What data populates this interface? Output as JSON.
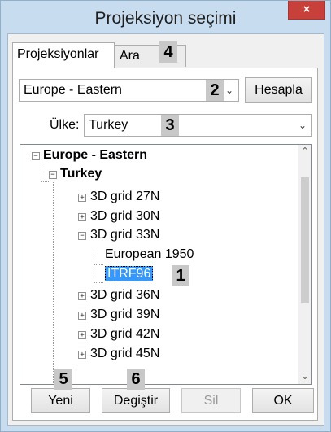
{
  "window": {
    "title": "Projeksiyon seçimi",
    "close_label": "×"
  },
  "tabs": [
    {
      "label": "Projeksiyonlar",
      "active": true
    },
    {
      "label": "Ara",
      "active": false
    }
  ],
  "region_combo": {
    "value": "Europe - Eastern"
  },
  "compute_button": {
    "label": "Hesapla"
  },
  "country": {
    "label": "Ülke:",
    "value": "Turkey"
  },
  "tree": {
    "root": "Europe - Eastern",
    "country": "Turkey",
    "items": [
      {
        "label": "3D grid  27N",
        "expanded": false
      },
      {
        "label": "3D grid  30N",
        "expanded": false
      },
      {
        "label": "3D grid  33N",
        "expanded": true,
        "children": [
          "European 1950",
          "ITRF96"
        ]
      },
      {
        "label": "3D grid  36N",
        "expanded": false
      },
      {
        "label": "3D grid  39N",
        "expanded": false
      },
      {
        "label": "3D grid  42N",
        "expanded": false
      },
      {
        "label": "3D grid  45N",
        "expanded": false
      }
    ],
    "selected": "ITRF96"
  },
  "buttons": {
    "new": "Yeni",
    "change": "Degiştir",
    "delete": "Sil",
    "ok": "OK"
  },
  "annotations": [
    "1",
    "2",
    "3",
    "4",
    "5",
    "6"
  ],
  "icons": {
    "expand": "+",
    "collapse": "−",
    "dropdown": "⌄",
    "scroll_up": "⌃",
    "scroll_down": "⌄"
  }
}
